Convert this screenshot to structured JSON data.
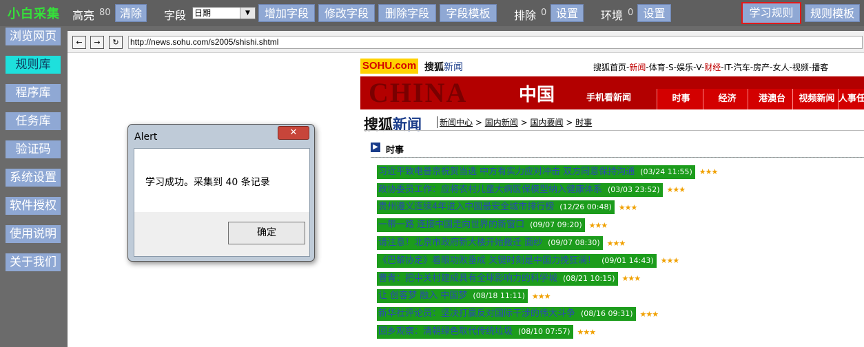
{
  "toolbar": {
    "brand": "小白采集",
    "highlight_label": "高亮",
    "highlight_count": "80",
    "clear_button": "清除",
    "field_label": "字段",
    "field_select": "日期",
    "add_field": "增加字段",
    "edit_field": "修改字段",
    "delete_field": "删除字段",
    "field_template": "字段模板",
    "exclude_label": "排除",
    "exclude_count": "0",
    "exclude_settings": "设置",
    "env_label": "环境",
    "env_count": "0",
    "env_settings": "设置",
    "learn_rules": "学习规则",
    "rule_template": "规则模板"
  },
  "sidebar": {
    "items": [
      {
        "label": "浏览网页"
      },
      {
        "label": "规则库"
      },
      {
        "label": "程序库"
      },
      {
        "label": "任务库"
      },
      {
        "label": "验证码"
      },
      {
        "label": "系统设置"
      },
      {
        "label": "软件授权"
      },
      {
        "label": "使用说明"
      },
      {
        "label": "关于我们"
      }
    ]
  },
  "browser": {
    "url": "http://news.sohu.com/s2005/shishi.shtml",
    "back": "←",
    "forward": "→",
    "refresh": "↻"
  },
  "page": {
    "logo": "SOHU.com",
    "sohu_news_prefix": "搜狐",
    "sohu_news_suffix": "新闻",
    "topnav": [
      "搜狐首页",
      "新闻",
      "体育",
      "S",
      "娱乐",
      "V",
      "财经",
      "IT",
      "汽车",
      "房产",
      "女人",
      "视频",
      "播客"
    ],
    "banner_china": "CHINA",
    "banner_zh": "中国",
    "banner_mobile": "手机看新闻",
    "banner_tabs": [
      "时事",
      "经济",
      "港澳台",
      "视频新闻",
      "人事任"
    ],
    "big_title_1": "搜狐",
    "big_title_2": "新闻",
    "breadcrumb": [
      "新闻中心",
      "国内新闻",
      "国内要闻",
      "时事"
    ],
    "breadcrumb_sep": ">",
    "section": "时事",
    "news": [
      {
        "title": "习近平致电普京祝贺当选 中方有实力应对冲击 双方同意保持沟通",
        "date": "(03/24 11:55)",
        "stars": "★★★"
      },
      {
        "title": "政协委员工作：应将农村儿童大病医保模型纳入健康体系",
        "date": "(03/03 23:52)",
        "stars": "★★★"
      },
      {
        "title": "贵州遵义连续4年进入中国最安全城市排行榜",
        "date": "(12/26 00:48)",
        "stars": "★★★"
      },
      {
        "title": "一带一路 连接中国走向世界的新窗口",
        "date": "(09/07 09:20)",
        "stars": "★★★"
      },
      {
        "title": "请注意！北京市政府新大楼开始搬迁 面纱",
        "date": "(09/07 08:30)",
        "stars": "★★★"
      },
      {
        "title": "《巴黎协定》着眼功败垂成 关键时刻是中国力挽狂澜！",
        "date": "(09/01 14:43)",
        "stars": "★★★"
      },
      {
        "title": "曹青：把中关村建成具有全球影响力的科学城",
        "date": "(08/21 10:15)",
        "stars": "★★★"
      },
      {
        "title": "让 创客梦 融入 中国梦",
        "date": "(08/18 11:11)",
        "stars": "★★★"
      },
      {
        "title": "新华社评论员：坚决打赢反对国际干涉的伟大斗争",
        "date": "(08/16 09:31)",
        "stars": "★★★"
      },
      {
        "title": "回乡观察：清朝绿色取代传统垃圾",
        "date": "(08/10 07:57)",
        "stars": "★★★"
      }
    ]
  },
  "alert": {
    "title": "Alert",
    "close": "✕",
    "message": "学习成功。采集到 40 条记录",
    "ok": "确定"
  }
}
